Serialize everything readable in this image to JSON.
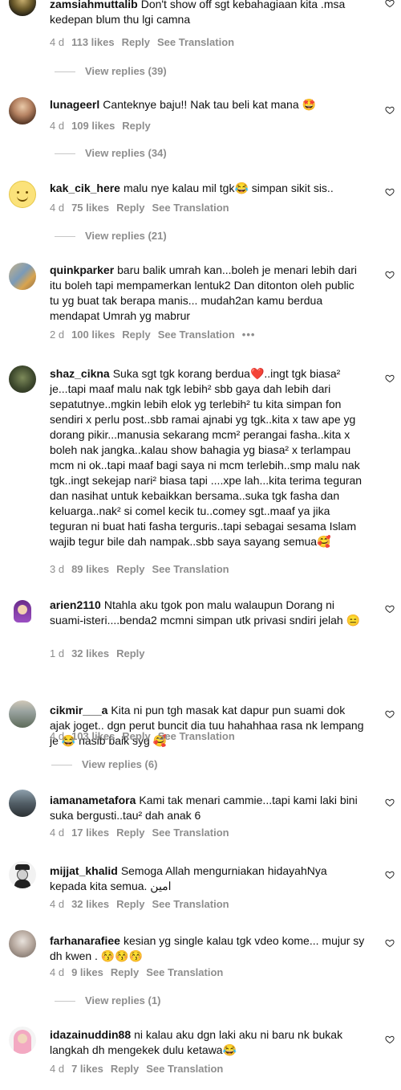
{
  "labels": {
    "reply": "Reply",
    "see_translation": "See Translation",
    "more": "•••"
  },
  "comments": [
    {
      "user": "zamsiahmuttalib",
      "text": "Don't show off sgt kebahagiaan kita .msa kedepan blum thu lgi camna",
      "age": "4 d",
      "likes": "113 likes",
      "replies": "View replies (39)"
    },
    {
      "user": "lunageerl",
      "text": "Canteknye baju!! Nak tau beli kat mana 🤩",
      "age": "4 d",
      "likes": "109 likes",
      "replies": "View replies (34)"
    },
    {
      "user": "kak_cik_here",
      "text": "malu nye kalau mil tgk😂 simpan sikit sis..",
      "age": "4 d",
      "likes": "75 likes",
      "replies": "View replies (21)"
    },
    {
      "user": "quinkparker",
      "text": "baru balik umrah kan...boleh je menari lebih dari itu boleh tapi mempamerkan lentuk2 Dan ditonton oleh public tu yg buat tak berapa manis... mudah2an kamu berdua mendapat Umrah yg mabrur",
      "age": "2 d",
      "likes": "100 likes"
    },
    {
      "user": "shaz_cikna",
      "text": "Suka sgt tgk korang berdua❤️..ingt tgk biasa² je...tapi maaf malu nak tgk lebih² sbb gaya dah lebih dari sepatutnye..mgkin lebih elok yg terlebih² tu kita simpan fon sendiri x perlu post..sbb ramai ajnabi yg tgk..kita x taw ape yg dorang pikir...manusia sekarang mcm² perangai fasha..kita x boleh nak jangka..kalau show bahagia yg biasa² x terlampau mcm ni ok..tapi maaf bagi saya ni mcm terlebih..smp malu nak tgk..ingt sekejap nari² biasa tapi ....xpe lah...kita terima teguran dan nasihat untuk kebaikkan bersama..suka tgk fasha dan keluarga..nak² si comel kecik tu..comey sgt..maaf ya jika teguran ni buat hati fasha terguris..tapi sebagai sesama Islam wajib tegur bile dah nampak..sbb saya sayang semua🥰",
      "age": "3 d",
      "likes": "89 likes"
    },
    {
      "user": "arien2110",
      "text": "Ntahla aku tgok pon malu walaupun Dorang ni suami-isteri....benda2 mcmni simpan utk privasi sndiri jelah 😑",
      "age": "1 d",
      "likes": "32 likes"
    },
    {
      "user": "cikmir___a",
      "text": "Kita ni pun tgh masak kat dapur pun suami dok ajak joget.. dgn perut buncit dia tuu hahahhaa rasa nk lempang je 😂 nasib baik syg 🥰",
      "age": "4 d",
      "likes": "103 likes",
      "replies": "View replies (6)"
    },
    {
      "user": "iamanametafora",
      "text": "Kami tak menari cammie...tapi kami laki bini suka bergusti..tau² dah anak 6",
      "age": "4 d",
      "likes": "17 likes"
    },
    {
      "user": "mijjat_khalid",
      "text": "Semoga Allah mengurniakan hidayahNya kepada kita semua. امين",
      "age": "4 d",
      "likes": "32 likes"
    },
    {
      "user": "farhanarafiee",
      "text": "kesian yg single kalau tgk vdeo kome... mujur sy dh kwen . 😚😚😚",
      "age": "4 d",
      "likes": "9 likes",
      "replies": "View replies (1)"
    },
    {
      "user": "idazainuddin88",
      "text": "ni kalau aku dgn laki aku ni baru nk bukak langkah dh mengekek dulu ketawa😂",
      "age": "4 d",
      "likes": "7 likes"
    }
  ]
}
